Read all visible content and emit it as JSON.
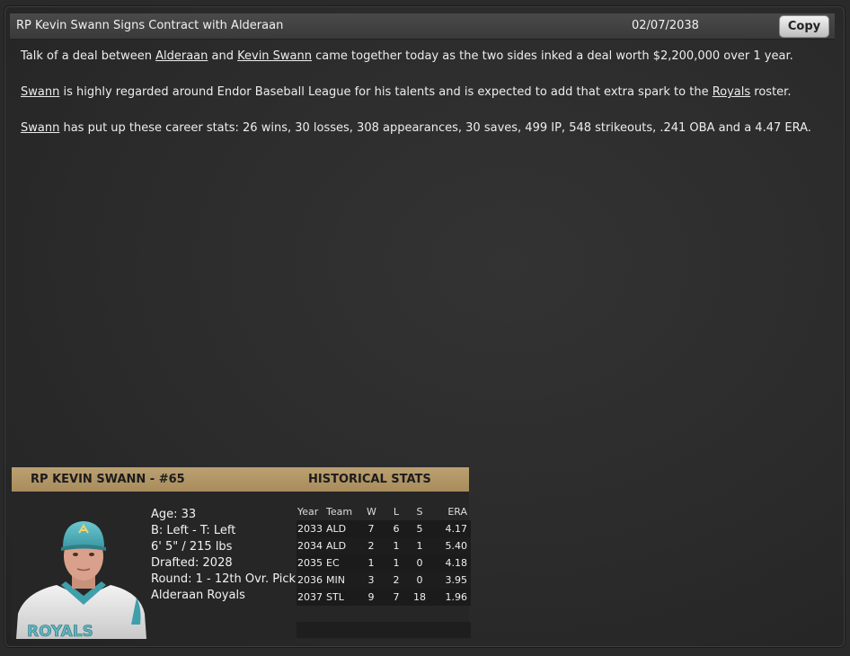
{
  "header": {
    "title": "RP Kevin Swann Signs Contract with Alderaan",
    "date": "02/07/2038",
    "copy_label": "Copy"
  },
  "article": {
    "p1": {
      "t1": "Talk of a deal between ",
      "l1": "Alderaan",
      "t2": " and ",
      "l2": "Kevin Swann",
      "t3": " came together today as the two sides inked a deal worth $2,200,000 over 1 year."
    },
    "p2": {
      "l1": "Swann",
      "t1": " is highly regarded around Endor Baseball League for his talents and is expected to add that extra spark to the ",
      "l2": "Royals",
      "t2": " roster."
    },
    "p3": {
      "l1": "Swann",
      "t1": " has put up these career stats: 26 wins, 30 losses, 308 appearances, 30 saves, 499 IP, 548 strikeouts, .241 OBA and a 4.47 ERA."
    }
  },
  "card": {
    "name": "RP KEVIN SWANN - #65",
    "historical_title": "HISTORICAL STATS",
    "bio": {
      "age": "Age: 33",
      "bats_throws": "B: Left - T: Left",
      "height_weight": "6' 5\" / 215 lbs",
      "drafted": "Drafted: 2028",
      "round": "Round: 1 - 12th Ovr. Pick",
      "team": "Alderaan Royals"
    },
    "stats": {
      "headers": {
        "year": "Year",
        "team": "Team",
        "w": "W",
        "l": "L",
        "s": "S",
        "era": "ERA"
      },
      "rows": [
        {
          "year": "2033",
          "team": "ALD",
          "w": "7",
          "l": "6",
          "s": "5",
          "era": "4.17"
        },
        {
          "year": "2034",
          "team": "ALD",
          "w": "2",
          "l": "1",
          "s": "1",
          "era": "5.40"
        },
        {
          "year": "2035",
          "team": "EC",
          "w": "1",
          "l": "1",
          "s": "0",
          "era": "4.18"
        },
        {
          "year": "2036",
          "team": "MIN",
          "w": "3",
          "l": "2",
          "s": "0",
          "era": "3.95"
        },
        {
          "year": "2037",
          "team": "STL",
          "w": "9",
          "l": "7",
          "s": "18",
          "era": "1.96"
        }
      ]
    },
    "jersey_text": "ROYALS",
    "cap_letter": "A"
  },
  "colors": {
    "card_header": "#b09463",
    "cap": "#4fb3bf",
    "jersey": "#e8e8e8"
  }
}
